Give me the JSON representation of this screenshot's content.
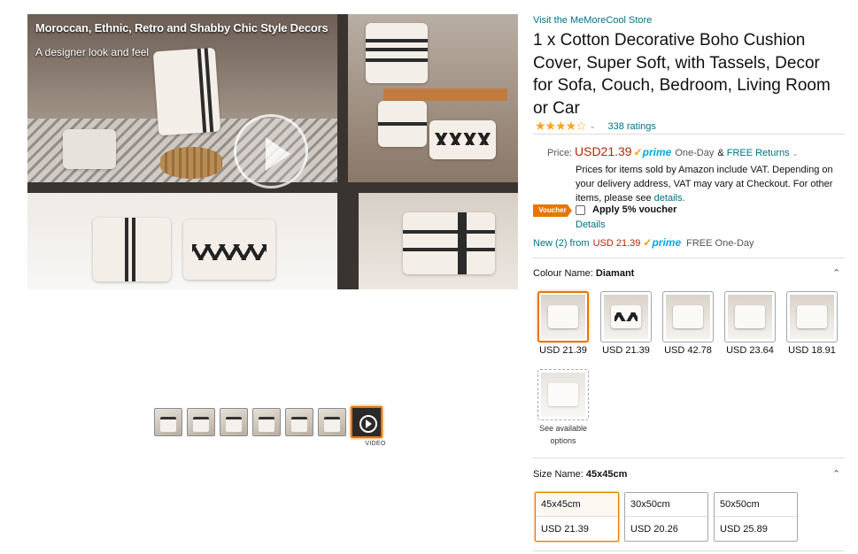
{
  "media": {
    "caption_line1": "Moroccan, Ethnic, Retro and Shabby Chic Style Decors",
    "caption_line2": "A designer look and feel",
    "video_label": "VIDEO",
    "thumbnail_count": 7,
    "selected_thumbnail": 7
  },
  "product": {
    "store_link": "Visit the MeMoreCool Store",
    "title": "1 x Cotton Decorative Boho Cushion Cover, Super Soft, with Tassels, Decor for Sofa, Couch, Bedroom, Living Room or Car",
    "stars": "★★★★☆",
    "rating_value": 4.5,
    "ratings_count": "338 ratings"
  },
  "price": {
    "label": "Price:",
    "value": "USD21.39",
    "prime": "prime",
    "delivery": "One-Day",
    "amp": "&",
    "free_returns": "FREE Returns",
    "vat_note": "Prices for items sold by Amazon include VAT. Depending on your delivery address, VAT may vary at Checkout. For other items, please see",
    "vat_details_link": "details.",
    "voucher_badge": "Voucher",
    "voucher_text": "Apply 5% voucher",
    "voucher_details": "Details",
    "new_from_link": "New (2) from",
    "new_from_price": "USD 21.39",
    "new_from_delivery": "FREE One-Day"
  },
  "colour": {
    "label": "Colour Name:",
    "selected": "Diamant",
    "swatches": [
      {
        "price": "USD 21.39"
      },
      {
        "price": "USD 21.39"
      },
      {
        "price": "USD 42.78"
      },
      {
        "price": "USD 23.64"
      },
      {
        "price": "USD 18.91"
      }
    ],
    "more_label": "See available options"
  },
  "size": {
    "label": "Size Name:",
    "selected": "45x45cm",
    "options": [
      {
        "name": "45x45cm",
        "price": "USD 21.39"
      },
      {
        "name": "30x50cm",
        "price": "USD 20.26"
      },
      {
        "name": "50x50cm",
        "price": "USD 25.89"
      }
    ]
  },
  "colors": {
    "link": "#007185",
    "price": "#b12704",
    "accent": "#e77600",
    "stars": "#ffa41c",
    "prime": "#00a8e1"
  }
}
